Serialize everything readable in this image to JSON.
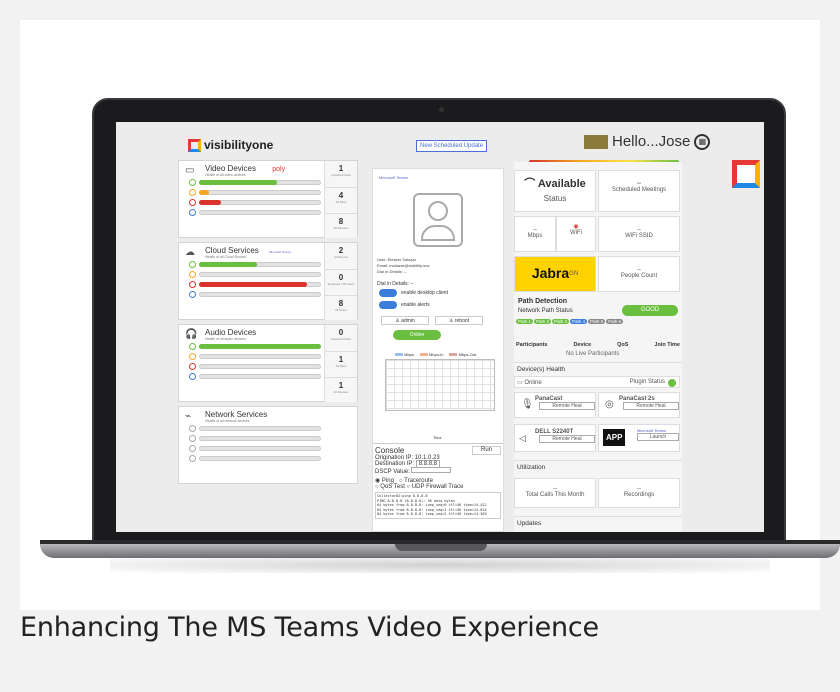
{
  "caption": "Enhancing The MS Teams Video Experience",
  "app": {
    "brand": "visibilityone",
    "scheduled_update": "New Scheduled Update",
    "greeting": "Hello...Jose",
    "meter_value": "100"
  },
  "sections": [
    {
      "title": "Video Devices",
      "brand": "poly",
      "sub": "Health of all video devices",
      "counts": [
        {
          "n": "1",
          "l": "Impacted Sites"
        },
        {
          "n": "4",
          "l": "All Sites"
        },
        {
          "n": "8",
          "l": "All Devices"
        }
      ]
    },
    {
      "title": "Cloud Services",
      "brand": "Microsoft Teams",
      "sub": "Health of all Cloud Rooms",
      "counts": [
        {
          "n": "2",
          "l": "All Rooms"
        },
        {
          "n": "0",
          "l": "Impacted VIP Users"
        },
        {
          "n": "8",
          "l": "All Users"
        }
      ]
    },
    {
      "title": "Audio Devices",
      "brand": "",
      "sub": "Health of all audio devices",
      "counts": [
        {
          "n": "0",
          "l": "Impacted Sites"
        },
        {
          "n": "1",
          "l": "All Sites"
        },
        {
          "n": "1",
          "l": "All Devices"
        }
      ]
    },
    {
      "title": "Network Services",
      "brand": "",
      "sub": "Health of all network devices",
      "counts": []
    }
  ],
  "mid": {
    "teams": "Microsoft Teams",
    "user": "User: Eleazer Salazar",
    "email": "Email: esalazar@visibility.one",
    "dial": "Dial In Details: --",
    "dial2": "Dial in Details: --",
    "toggle1": "enable desktop client",
    "toggle2": "enable alerts",
    "admin": "admin",
    "reboot": "reboot",
    "online": "Online",
    "legend": [
      "Mbps",
      "Mbps-In",
      "Mbps-Out"
    ],
    "time": "Time",
    "console": "Console",
    "run": "Run",
    "orig_label": "Origination IP:",
    "orig": "10.1.0.23",
    "dest_label": "Destination IP:",
    "dest": "8.8.8.8",
    "dscp": "DSCP Value:",
    "ping": "Ping",
    "traceroute": "Traceroute",
    "qos": "QoS Test",
    "udp": "UDP Firewall Trace",
    "log": [
      "Collector02:ping 8.8.8.8",
      "PING 8.8.8.8 (8.8.8.8): 56 data bytes",
      "64 bytes from 8.8.8.8: icmp_seq=0 ttl=56 time=14.422",
      "64 bytes from 8.8.8.8: icmp_seq=1 ttl=56 time=14.024",
      "64 bytes from 8.8.8.8: icmp_seq=2 ttl=56 time=14.369"
    ]
  },
  "right": {
    "available": "Available",
    "status": "Status",
    "meetings_v": "--",
    "meetings": "Scheduled Meetings",
    "mbps_v": "--",
    "mbps": "Mbps",
    "wifi": "WiFi",
    "ssid_v": "--",
    "ssid": "WiFi SSID",
    "jabra": "Jabra",
    "gn": "GN",
    "people_v": "--",
    "people": "People Count",
    "path": "Path Detection",
    "nps": "Network Path Status",
    "good": "GOOD",
    "paths": [
      "Path 1",
      "Path 2",
      "Path 3",
      "Path 4",
      "Path 5",
      "Path 6"
    ],
    "participants": "Participants",
    "device": "Device",
    "qos": "QoS",
    "join": "Join Time",
    "nolive": "No Live Participants",
    "health": "Device(s) Health",
    "online": "Online",
    "plugin": "Plugin Status",
    "d1": "PanaCast",
    "d2": "PanaCast 2s",
    "d3": "DELL S2240T",
    "heal": "Remote Heal",
    "app": "APP",
    "teams": "Microsoft Teams",
    "launch": "Launch",
    "util": "Utilization",
    "calls_v": "--",
    "calls": "Total Calls This Month",
    "rec_v": "--",
    "rec": "Recordings",
    "updates": "Updates"
  },
  "colors": {
    "green": "#6abf40",
    "orange": "#f5a623",
    "red": "#d9332b",
    "blue": "#3b7dd8"
  }
}
